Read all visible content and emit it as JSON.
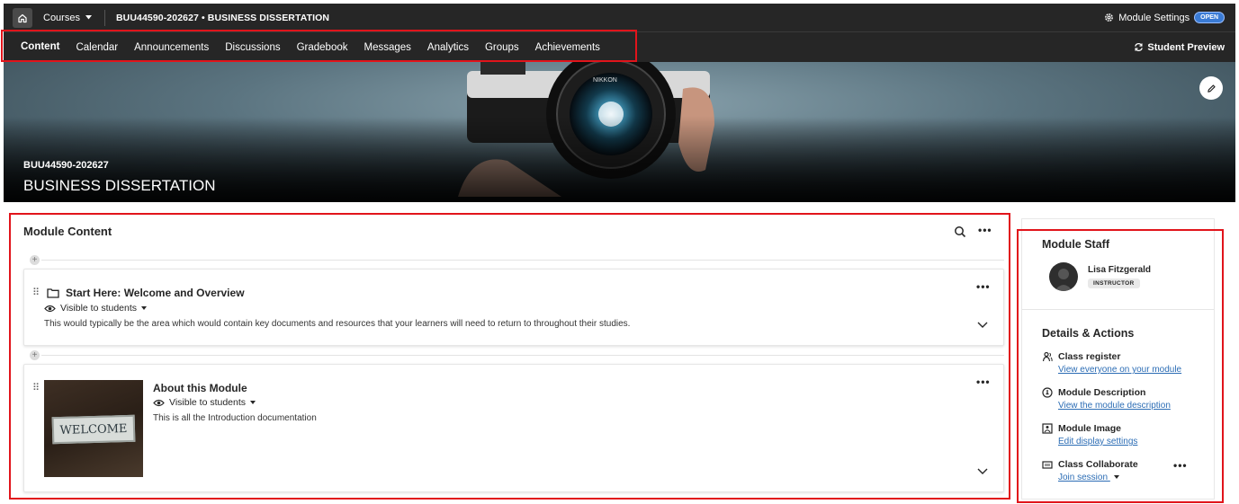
{
  "topbar": {
    "courses_label": "Courses",
    "course_code": "BUU44590-202627",
    "separator": "•",
    "course_name": "BUSINESS DISSERTATION",
    "module_settings_label": "Module Settings",
    "open_badge": "OPEN"
  },
  "nav": {
    "tabs": [
      {
        "label": "Content"
      },
      {
        "label": "Calendar"
      },
      {
        "label": "Announcements"
      },
      {
        "label": "Discussions"
      },
      {
        "label": "Gradebook"
      },
      {
        "label": "Messages"
      },
      {
        "label": "Analytics"
      },
      {
        "label": "Groups"
      },
      {
        "label": "Achievements"
      }
    ],
    "student_preview_label": "Student Preview"
  },
  "banner": {
    "code": "BUU44590-202627",
    "title": "BUSINESS DISSERTATION",
    "camera_brand": "NIKKON"
  },
  "content": {
    "title": "Module Content",
    "items": [
      {
        "title": "Start Here: Welcome and Overview",
        "visibility": "Visible to students",
        "description": "This would typically be the area which would contain key documents and resources that your learners will need to return to throughout their studies."
      },
      {
        "title": "About this Module",
        "visibility": "Visible to students",
        "description": "This is all the Introduction documentation",
        "thumbnail_text": "WELCOME"
      }
    ]
  },
  "sidebar": {
    "staff_title": "Module Staff",
    "staff_name": "Lisa Fitzgerald",
    "staff_role": "INSTRUCTOR",
    "details_title": "Details & Actions",
    "actions": [
      {
        "label": "Class register",
        "link": "View everyone on your module"
      },
      {
        "label": "Module Description",
        "link": "View the module description"
      },
      {
        "label": "Module Image",
        "link": "Edit display settings"
      },
      {
        "label": "Class Collaborate",
        "link": "Join session"
      }
    ]
  },
  "colors": {
    "dark_bar": "#262626",
    "highlight_red": "#e1141b",
    "link_blue": "#2c6db5",
    "badge_blue": "#3a7bd5"
  }
}
